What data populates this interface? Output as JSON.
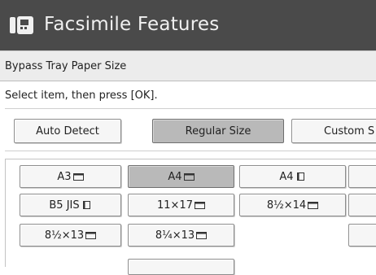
{
  "header": {
    "title": "Facsimile Features",
    "app_icon": "fax-machine-icon"
  },
  "section": {
    "label": "Bypass Tray Paper Size"
  },
  "instruction": "Select item, then press [OK].",
  "mode_tabs": [
    {
      "label": "Auto Detect",
      "selected": false
    },
    {
      "label": "Regular Size",
      "selected": true
    },
    {
      "label": "Custom S",
      "selected": false
    }
  ],
  "paper_sizes": [
    {
      "label": "A3",
      "orientation": "landscape",
      "selected": false
    },
    {
      "label": "A4",
      "orientation": "landscape",
      "selected": true
    },
    {
      "label": "A4",
      "orientation": "portrait",
      "selected": false
    },
    {
      "label": "B5 JIS",
      "orientation": "portrait",
      "selected": false
    },
    {
      "label": "11×17",
      "orientation": "landscape",
      "selected": false
    },
    {
      "label": "8½×14",
      "orientation": "landscape",
      "selected": false
    },
    {
      "label": "8½×13",
      "orientation": "landscape",
      "selected": false
    },
    {
      "label": "8¼×13",
      "orientation": "landscape",
      "selected": false
    }
  ],
  "colors": {
    "title_bar": "#4a4a4a",
    "selected_button": "#b9b9b9",
    "button": "#f6f6f6"
  }
}
